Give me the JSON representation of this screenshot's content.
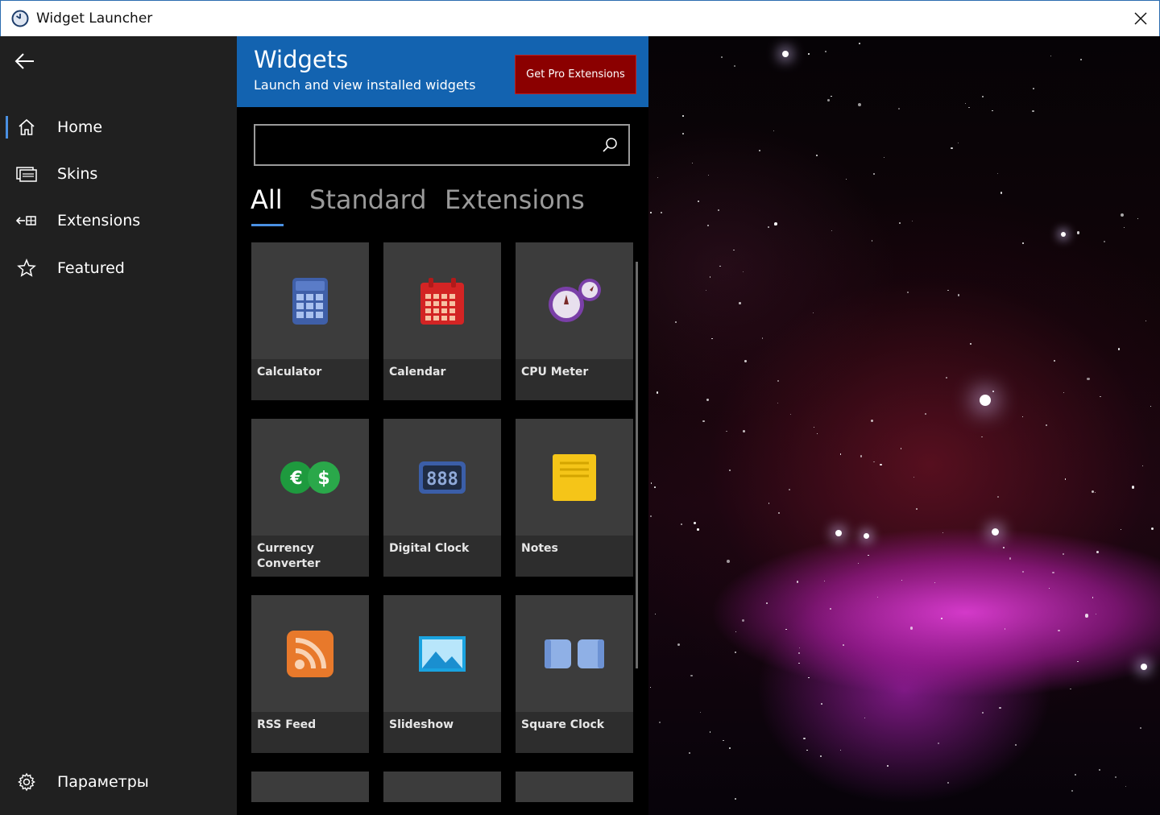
{
  "window": {
    "title": "Widget Launcher"
  },
  "nav": {
    "items": [
      {
        "label": "Home",
        "icon": "home-icon",
        "active": true
      },
      {
        "label": "Skins",
        "icon": "skins-icon"
      },
      {
        "label": "Extensions",
        "icon": "extensions-icon"
      },
      {
        "label": "Featured",
        "icon": "star-icon"
      }
    ],
    "settings_label": "Параметры"
  },
  "header": {
    "title": "Widgets",
    "subtitle": "Launch and view installed widgets",
    "pro_button": "Get Pro Extensions"
  },
  "search": {
    "value": "",
    "placeholder": ""
  },
  "tabs": [
    {
      "label": "All",
      "active": true
    },
    {
      "label": "Standard"
    },
    {
      "label": "Extensions"
    }
  ],
  "widgets": [
    {
      "label": "Calculator",
      "icon": "calculator-icon"
    },
    {
      "label": "Calendar",
      "icon": "calendar-icon"
    },
    {
      "label": "CPU Meter",
      "icon": "cpu-meter-icon"
    },
    {
      "label": "Currency Converter",
      "icon": "currency-icon"
    },
    {
      "label": "Digital Clock",
      "icon": "digital-clock-icon"
    },
    {
      "label": "Notes",
      "icon": "notes-icon"
    },
    {
      "label": "RSS Feed",
      "icon": "rss-icon"
    },
    {
      "label": "Slideshow",
      "icon": "slideshow-icon"
    },
    {
      "label": "Square Clock",
      "icon": "square-clock-icon"
    }
  ],
  "colors": {
    "accent": "#4a90e2",
    "header_blue": "#1363b0",
    "pro_button_red": "#8b0000",
    "nav_bg": "#202020"
  }
}
